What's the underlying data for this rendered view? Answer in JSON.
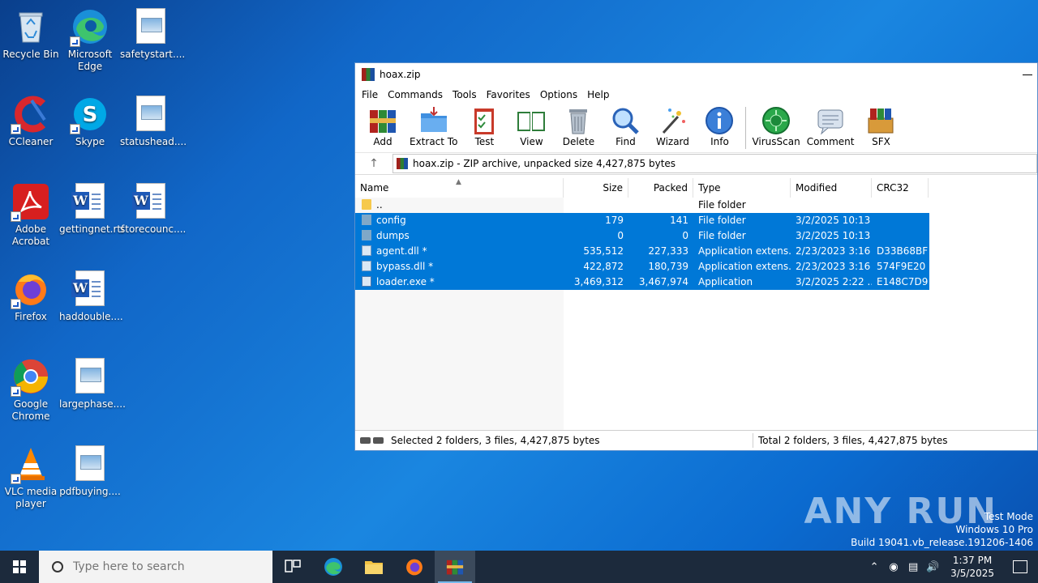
{
  "desktop": {
    "icons": [
      {
        "label": "Recycle Bin"
      },
      {
        "label": "Microsoft Edge"
      },
      {
        "label": "safetystart...."
      },
      {
        "label": "CCleaner"
      },
      {
        "label": "Skype"
      },
      {
        "label": "statushead...."
      },
      {
        "label": "Adobe Acrobat"
      },
      {
        "label": "gettingnet.rtf"
      },
      {
        "label": "storecounc...."
      },
      {
        "label": "Firefox"
      },
      {
        "label": "haddouble...."
      },
      {
        "label": "Google Chrome"
      },
      {
        "label": "largephase...."
      },
      {
        "label": "VLC media player"
      },
      {
        "label": "pdfbuying...."
      }
    ]
  },
  "window": {
    "title": "hoax.zip",
    "menu": [
      "File",
      "Commands",
      "Tools",
      "Favorites",
      "Options",
      "Help"
    ],
    "toolbar": [
      {
        "label": "Add",
        "icon": "add-archive-icon"
      },
      {
        "label": "Extract To",
        "icon": "extract-folder-icon"
      },
      {
        "label": "Test",
        "icon": "test-clipboard-icon"
      },
      {
        "label": "View",
        "icon": "view-book-icon"
      },
      {
        "label": "Delete",
        "icon": "trash-icon"
      },
      {
        "label": "Find",
        "icon": "magnifier-icon"
      },
      {
        "label": "Wizard",
        "icon": "wand-icon"
      },
      {
        "label": "Info",
        "icon": "info-icon"
      },
      {
        "label": "VirusScan",
        "icon": "virus-icon"
      },
      {
        "label": "Comment",
        "icon": "comment-icon"
      },
      {
        "label": "SFX",
        "icon": "sfx-icon"
      }
    ],
    "address": "hoax.zip - ZIP archive, unpacked size 4,427,875 bytes",
    "columns": [
      "Name",
      "Size",
      "Packed",
      "Type",
      "Modified",
      "CRC32"
    ],
    "rows": [
      {
        "name": "..",
        "size": "",
        "packed": "",
        "type": "File folder",
        "modified": "",
        "crc": "",
        "selected": false,
        "kind": "folder"
      },
      {
        "name": "config",
        "size": "179",
        "packed": "141",
        "type": "File folder",
        "modified": "3/2/2025 10:13 ...",
        "crc": "",
        "selected": true,
        "kind": "folder"
      },
      {
        "name": "dumps",
        "size": "0",
        "packed": "0",
        "type": "File folder",
        "modified": "3/2/2025 10:13 ...",
        "crc": "",
        "selected": true,
        "kind": "folder"
      },
      {
        "name": "agent.dll *",
        "size": "535,512",
        "packed": "227,333",
        "type": "Application extens...",
        "modified": "2/23/2023 3:16 ...",
        "crc": "D33B68BF",
        "selected": true,
        "kind": "dll"
      },
      {
        "name": "bypass.dll *",
        "size": "422,872",
        "packed": "180,739",
        "type": "Application extens...",
        "modified": "2/23/2023 3:16 ...",
        "crc": "574F9E20",
        "selected": true,
        "kind": "dll"
      },
      {
        "name": "loader.exe *",
        "size": "3,469,312",
        "packed": "3,467,974",
        "type": "Application",
        "modified": "3/2/2025 2:22 ...",
        "crc": "E148C7D9",
        "selected": true,
        "kind": "exe"
      }
    ],
    "status_left": "Selected 2 folders, 3 files, 4,427,875 bytes",
    "status_right": "Total 2 folders, 3 files, 4,427,875 bytes"
  },
  "watermark": {
    "logo": "ANY RUN",
    "line1": "Test Mode",
    "line2": "Windows 10 Pro",
    "line3": "Build 19041.vb_release.191206-1406"
  },
  "taskbar": {
    "search_placeholder": "Type here to search",
    "time": "1:37 PM",
    "date": "3/5/2025"
  },
  "colors": {
    "selection": "#0078d7",
    "taskbar": "#1c2a3c"
  }
}
